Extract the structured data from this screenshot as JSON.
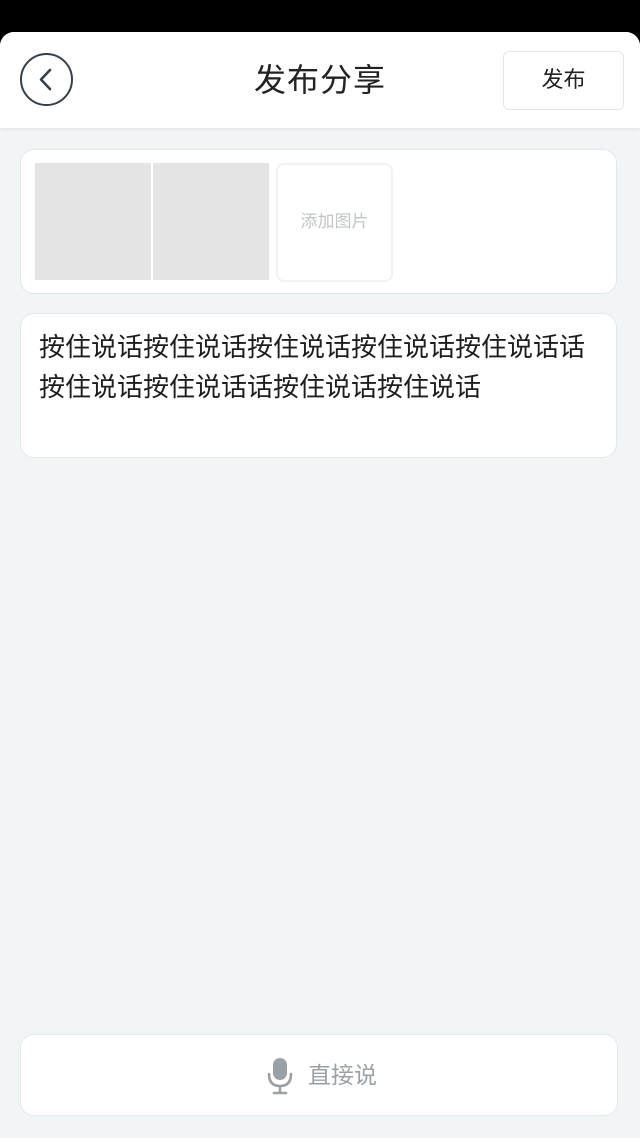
{
  "header": {
    "title": "发布分享",
    "publish_label": "发布",
    "back_icon": "chevron-left-icon"
  },
  "images": {
    "add_label": "添加图片",
    "thumbnail_count": 2
  },
  "post": {
    "content": "按住说话按住说话按住说话按住说话按住说话话按住说话按住说话话按住说话按住说话"
  },
  "voice": {
    "label": "直接说",
    "icon": "microphone-icon"
  },
  "colors": {
    "background": "#f1f5f6",
    "card": "#ffffff",
    "text": "#222222",
    "muted": "#9aa1a6"
  }
}
